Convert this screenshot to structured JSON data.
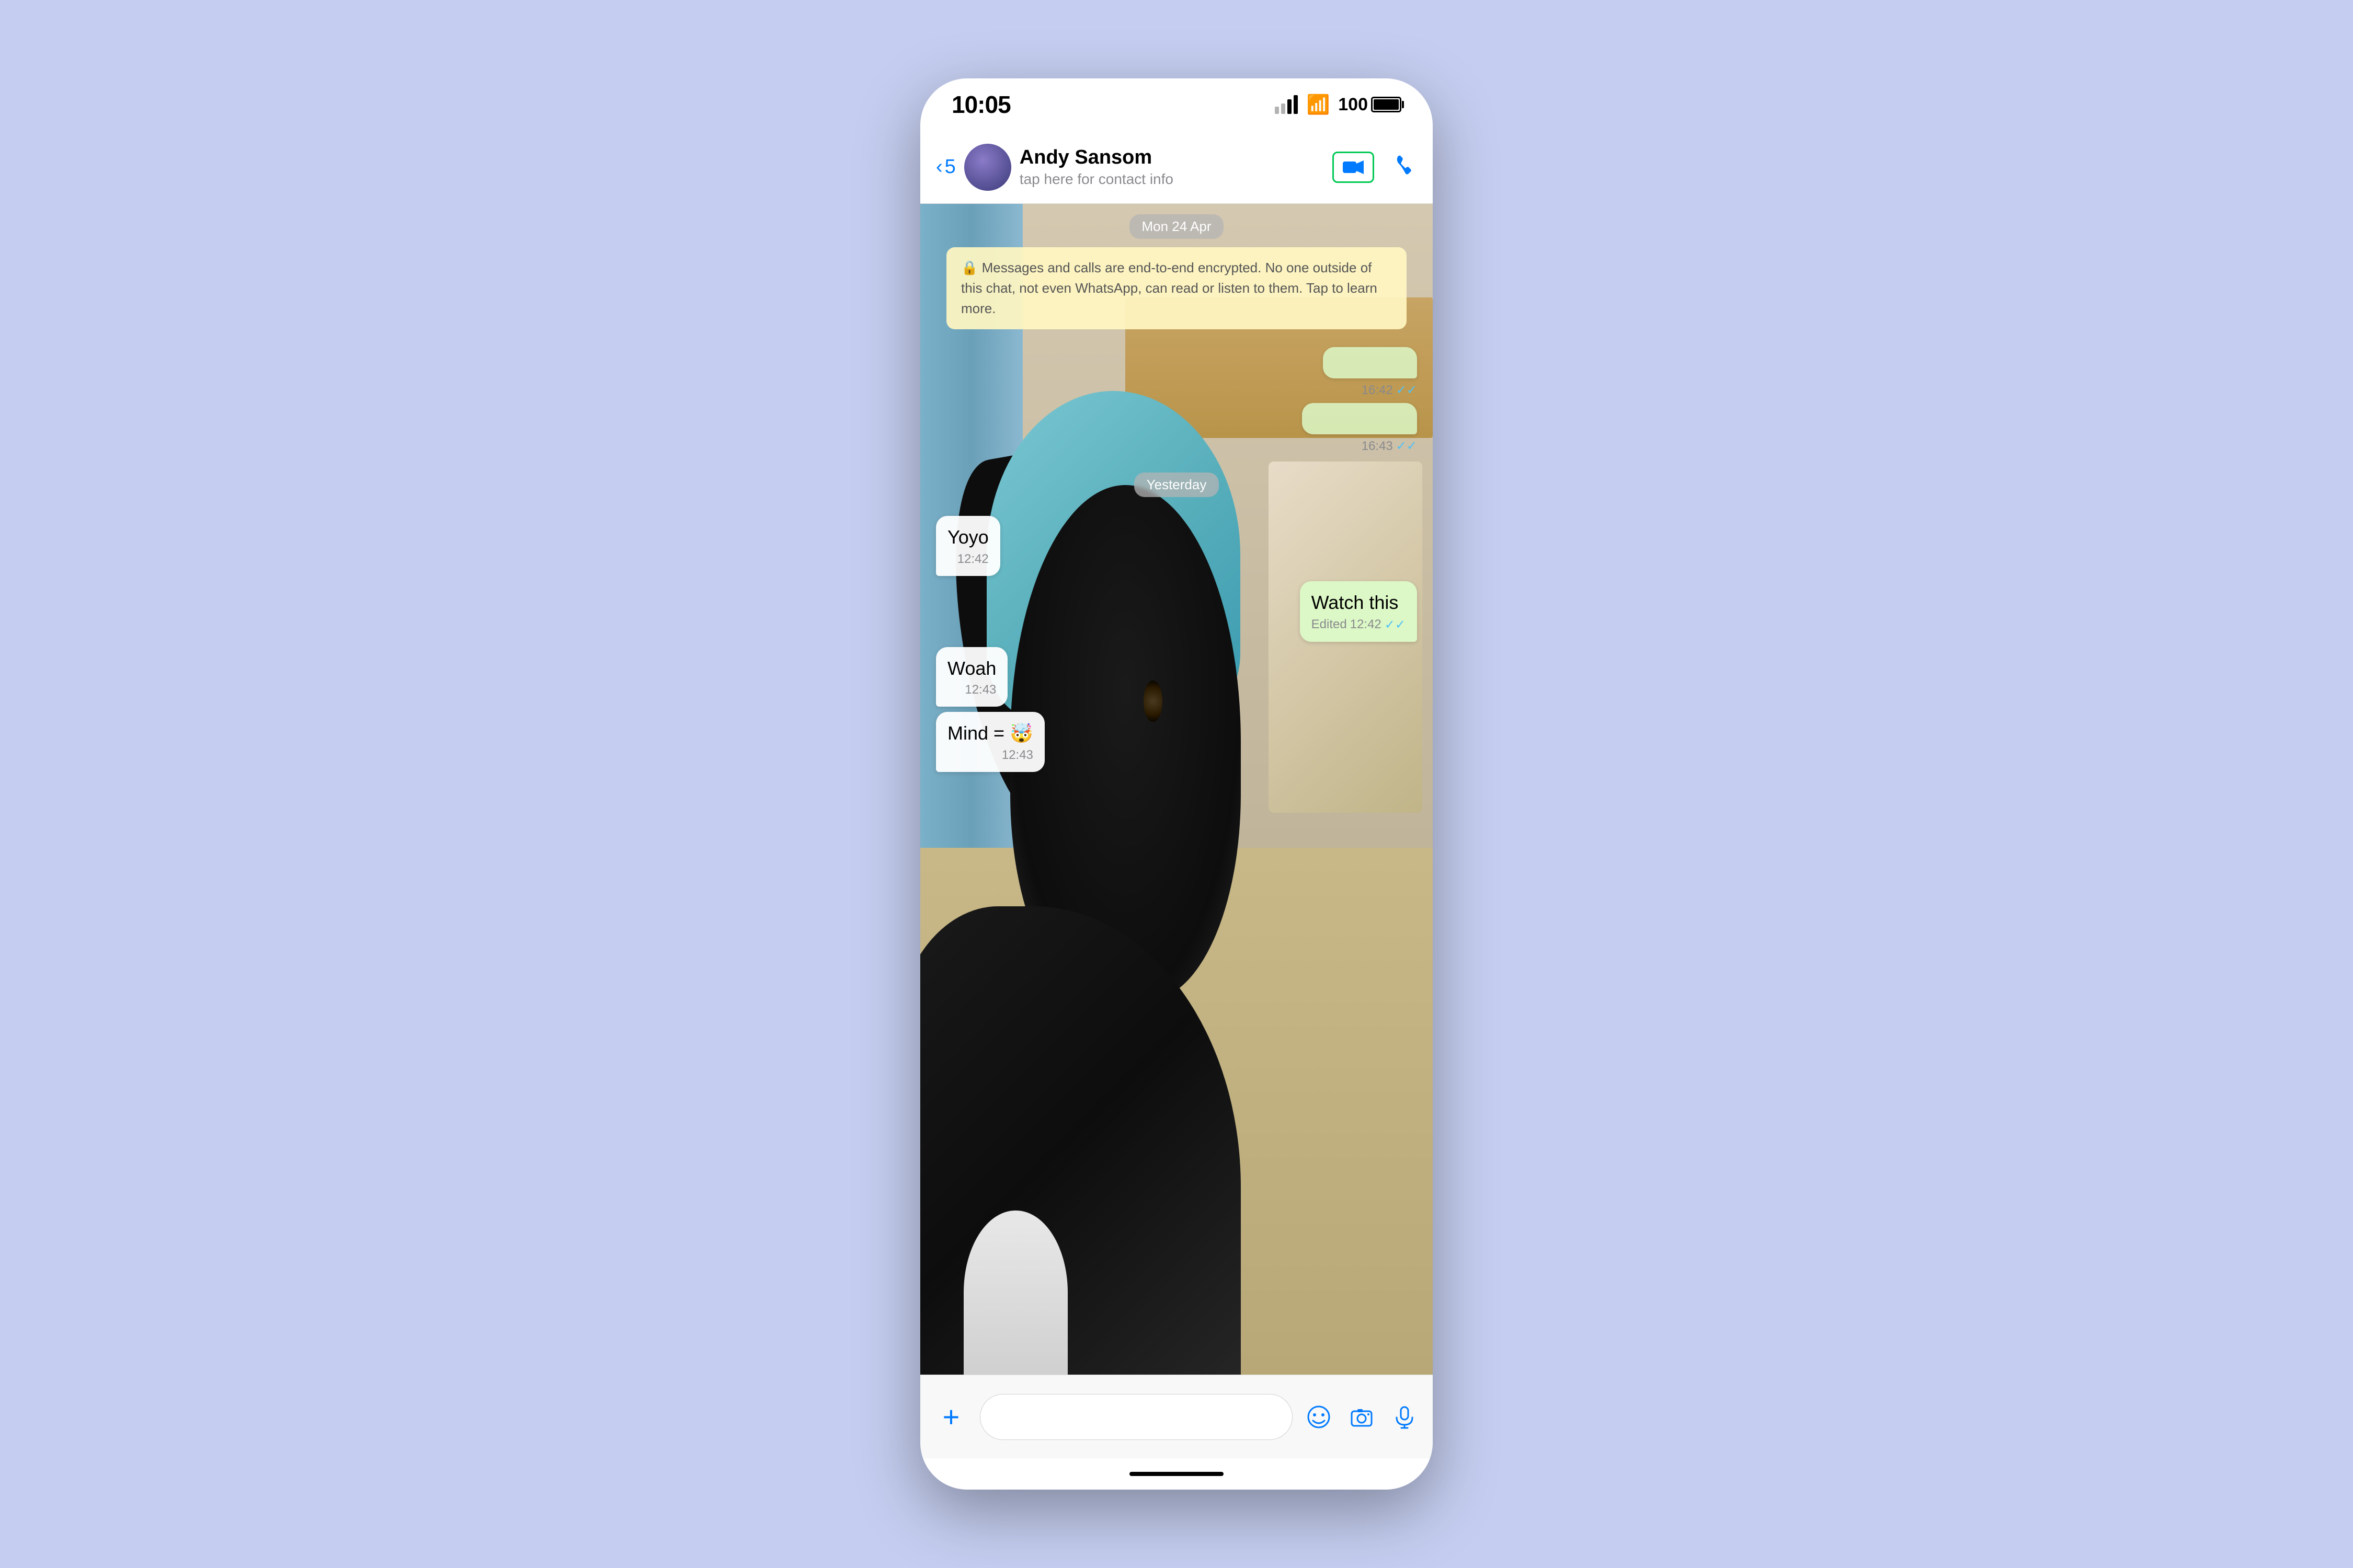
{
  "status_bar": {
    "time": "10:05",
    "battery_label": "100",
    "lock_icon": "🔒"
  },
  "header": {
    "back_count": "5",
    "contact_name": "Andy Sansom",
    "contact_sub": "tap here for contact info",
    "video_call_label": "📹",
    "phone_call_label": "📞",
    "back_chevron": "‹"
  },
  "chat": {
    "date_label": "Mon 24 Apr",
    "encryption_notice": "🔒 Messages and calls are end-to-end encrypted. No one outside of this chat, not even WhatsApp, can read or listen to them. Tap to learn more.",
    "day_separator": "Yesterday",
    "messages": [
      {
        "type": "sent",
        "text": "",
        "time": "16:42",
        "checks": "✓✓",
        "empty": true,
        "bubble_width": "180"
      },
      {
        "type": "sent",
        "text": "",
        "time": "16:43",
        "checks": "✓✓",
        "empty": true,
        "bubble_width": "220"
      },
      {
        "type": "received",
        "text": "Yoyo",
        "time": "12:42"
      },
      {
        "type": "sent",
        "text": "Watch this",
        "time": "12:42",
        "edited": "Edited",
        "checks": "✓✓"
      },
      {
        "type": "received",
        "text": "Woah",
        "time": "12:43"
      },
      {
        "type": "received",
        "text": "Mind = 🤯",
        "time": "12:43"
      }
    ]
  },
  "input_bar": {
    "placeholder": "",
    "plus_icon": "+",
    "sticker_icon": "🗨",
    "camera_icon": "📷",
    "mic_icon": "🎤"
  },
  "home_indicator": {
    "bar_label": ""
  }
}
